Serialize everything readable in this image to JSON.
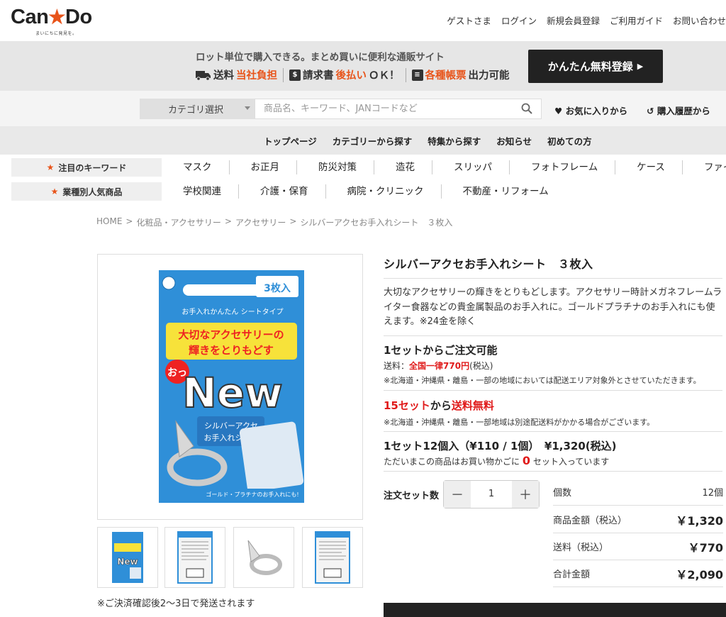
{
  "header": {
    "logo_text": "Can★Do",
    "logo_tagline": "まいにちに発見を。",
    "links": [
      "ゲストさま",
      "ログイン",
      "新規会員登録",
      "ご利用ガイド",
      "お問い合わせ"
    ]
  },
  "banner": {
    "headline": "ロット単位で購入できる。まとめ買いに便利な通販サイト",
    "feature1_prefix": "送料",
    "feature1_highlight": "当社負担",
    "feature2_prefix": "請求書",
    "feature2_highlight": "後払い",
    "feature2_suffix": "ＯＫ！",
    "feature3_highlight": "各種帳票",
    "feature3_suffix": "出力可能",
    "register_button": "かんたん無料登録"
  },
  "search": {
    "category_select": "カテゴリ選択",
    "placeholder": "商品名、キーワード、JANコードなど",
    "favorites_link": "お気に入りから",
    "history_link": "購入履歴から"
  },
  "nav": {
    "items": [
      "トップページ",
      "カテゴリーから探す",
      "特集から探す",
      "お知らせ",
      "初めての方"
    ]
  },
  "keywords": {
    "label": "注目のキーワード",
    "items": [
      "マスク",
      "お正月",
      "防災対策",
      "造花",
      "スリッパ",
      "フォトフレーム",
      "ケース",
      "ファイル"
    ]
  },
  "industry": {
    "label": "業種別人気商品",
    "items": [
      "学校関連",
      "介護・保育",
      "病院・クリニック",
      "不動産・リフォーム"
    ]
  },
  "breadcrumb": [
    "HOME",
    ">",
    "化粧品・アクセサリー",
    ">",
    "アクセサリー",
    ">",
    "シルバーアクセお手入れシート　３枚入"
  ],
  "product": {
    "title": "シルバーアクセお手入れシート　３枚入",
    "description": "大切なアクセサリーの輝きをとりもどします。アクセサリー時計メガネフレームライター食器などの貴金属製品のお手入れに。ゴールドプラチナのお手入れにも使えます。※24金を除く",
    "min_order": "1セットからご注文可能",
    "shipping_label": "送料：",
    "shipping_value": "全国一律770円",
    "shipping_tax": "(税込)",
    "shipping_note": "※北海道・沖縄県・離島・一部の地域においては配送エリア対象外とさせていただきます。",
    "free_ship_red": "15セット",
    "free_ship_mid": "から",
    "free_ship_red2": "送料無料",
    "free_ship_note": "※北海道・沖縄県・離島・一部地域は別途配送料がかかる場合がございます。",
    "set_info": "1セット12個入（¥110 / 1個）　¥1,320(税込)",
    "cart_prefix": "ただいまこの商品はお買い物かごに",
    "cart_count": "0",
    "cart_suffix": "セット入っています",
    "qty_label": "注文セット数",
    "qty_minus": "－",
    "qty_value": "1",
    "qty_plus": "＋",
    "ship_days_note": "※ご決済確認後2～3日で発送されます"
  },
  "package": {
    "count_badge": "3枚入",
    "subtitle": "お手入れかんたん シートタイプ",
    "slogan1": "大切なアクセサリーの",
    "slogan2": "輝きをとりもどす",
    "oh": "おっ",
    "new": "New",
    "tag1": "シルバーアクセ",
    "tag2": "お手入れシート",
    "footer": "ゴールド・プラチナのお手入れにも!"
  },
  "summary": {
    "rows": [
      {
        "label": "個数",
        "value": "12個"
      },
      {
        "label": "商品金額（税込）",
        "value": "￥1,320"
      },
      {
        "label": "送料（税込）",
        "value": "￥770"
      },
      {
        "label": "合計金額",
        "value": "￥2,090"
      }
    ]
  },
  "colors": {
    "accent": "#e8541a",
    "price_red": "#e01b1b",
    "package_blue": "#2f8fd8",
    "dark": "#222222"
  }
}
